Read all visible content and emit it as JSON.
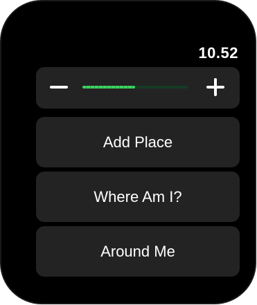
{
  "status": {
    "time": "10.52"
  },
  "stepper": {
    "decrement_icon": "minus-icon",
    "increment_icon": "plus-icon",
    "level": 0.5,
    "accent_color": "#3ed25f"
  },
  "menu": {
    "items": [
      {
        "label": "Add Place"
      },
      {
        "label": "Where Am I?"
      },
      {
        "label": "Around Me"
      }
    ]
  }
}
